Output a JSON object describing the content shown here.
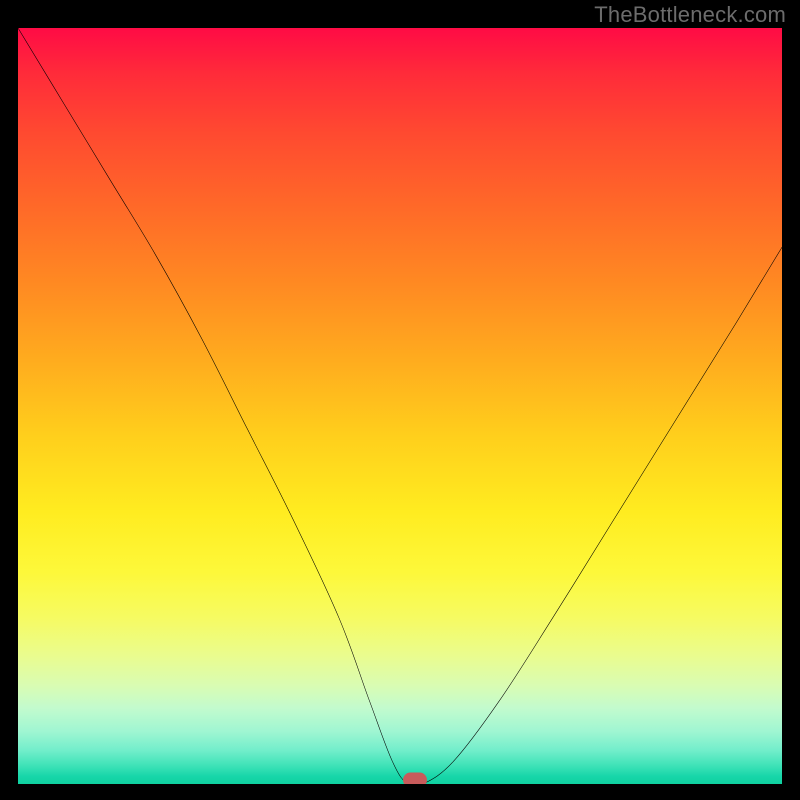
{
  "watermark": "TheBottleneck.com",
  "chart_data": {
    "type": "line",
    "title": "",
    "xlabel": "",
    "ylabel": "",
    "xlim": [
      0,
      100
    ],
    "ylim": [
      0,
      100
    ],
    "grid": false,
    "legend": false,
    "series": [
      {
        "name": "bottleneck-curve",
        "x": [
          0,
          6,
          12,
          18,
          24,
          30,
          36,
          42,
          46,
          49,
          51,
          53,
          57,
          63,
          70,
          78,
          86,
          94,
          100
        ],
        "values": [
          100,
          90,
          80,
          70,
          59,
          47,
          35,
          22,
          11,
          3,
          0,
          0,
          3,
          11,
          22,
          35,
          48,
          61,
          71
        ]
      }
    ],
    "marker": {
      "x": 52,
      "y": 0.5
    },
    "background": "rainbow-vertical-gradient",
    "colors": {
      "curve": "#000000",
      "marker": "#c85b5b",
      "frame": "#000000"
    }
  }
}
